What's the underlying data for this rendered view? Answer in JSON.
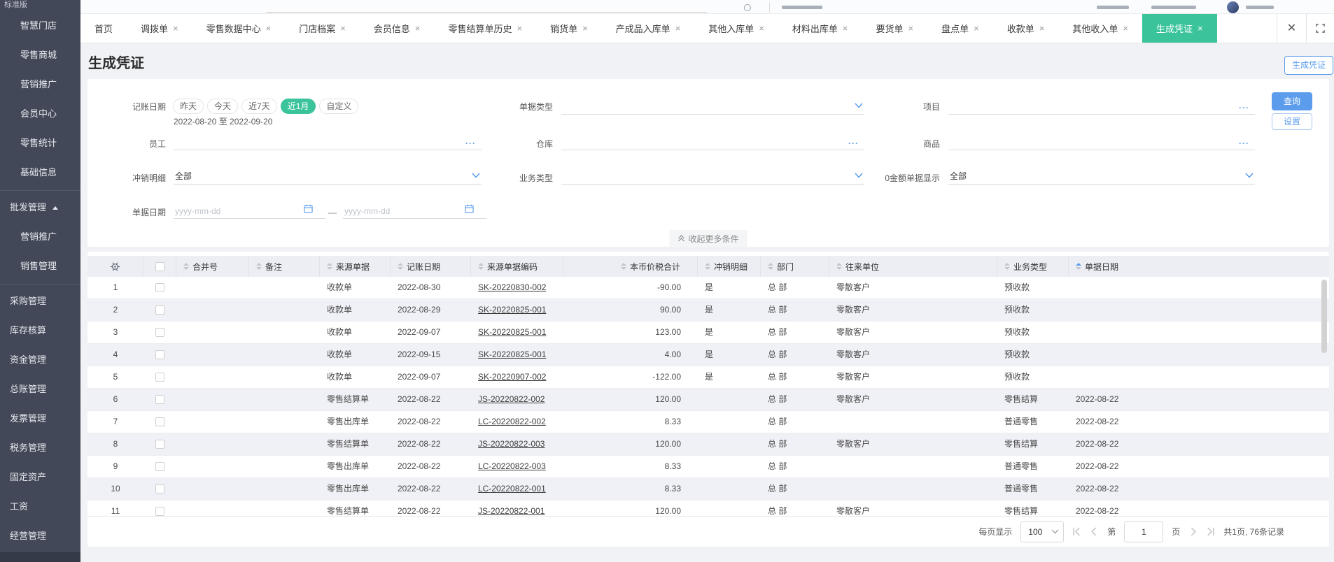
{
  "app": {
    "edition": "标准版"
  },
  "sidebar": {
    "items": [
      {
        "label": "智慧门店",
        "kind": "sub"
      },
      {
        "label": "零售商城",
        "kind": "sub"
      },
      {
        "label": "营销推广",
        "kind": "sub"
      },
      {
        "label": "会员中心",
        "kind": "sub"
      },
      {
        "label": "零售统计",
        "kind": "sub"
      },
      {
        "label": "基础信息",
        "kind": "sub"
      },
      {
        "kind": "sep"
      },
      {
        "label": "批发管理",
        "kind": "group",
        "expanded": true
      },
      {
        "label": "营销推广",
        "kind": "sub"
      },
      {
        "label": "销售管理",
        "kind": "sub"
      },
      {
        "kind": "sep"
      },
      {
        "label": "采购管理",
        "kind": "item"
      },
      {
        "label": "库存核算",
        "kind": "item"
      },
      {
        "label": "资金管理",
        "kind": "item"
      },
      {
        "label": "总账管理",
        "kind": "item"
      },
      {
        "label": "发票管理",
        "kind": "item"
      },
      {
        "label": "税务管理",
        "kind": "item"
      },
      {
        "label": "固定资产",
        "kind": "item"
      },
      {
        "label": "工资",
        "kind": "item"
      },
      {
        "label": "经营管理",
        "kind": "item"
      }
    ]
  },
  "tabs": {
    "items": [
      {
        "label": "首页",
        "closable": false,
        "active": false
      },
      {
        "label": "调拨单",
        "closable": true,
        "active": false
      },
      {
        "label": "零售数据中心",
        "closable": true,
        "active": false
      },
      {
        "label": "门店档案",
        "closable": true,
        "active": false
      },
      {
        "label": "会员信息",
        "closable": true,
        "active": false
      },
      {
        "label": "零售结算单历史",
        "closable": true,
        "active": false
      },
      {
        "label": "销货单",
        "closable": true,
        "active": false
      },
      {
        "label": "产成品入库单",
        "closable": true,
        "active": false
      },
      {
        "label": "其他入库单",
        "closable": true,
        "active": false
      },
      {
        "label": "材料出库单",
        "closable": true,
        "active": false
      },
      {
        "label": "要货单",
        "closable": true,
        "active": false
      },
      {
        "label": "盘点单",
        "closable": true,
        "active": false
      },
      {
        "label": "收款单",
        "closable": true,
        "active": false
      },
      {
        "label": "其他收入单",
        "closable": true,
        "active": false
      },
      {
        "label": "生成凭证",
        "closable": true,
        "active": true
      }
    ]
  },
  "page": {
    "title": "生成凭证",
    "generate_button": "生成凭证"
  },
  "filters": {
    "accounting_date_label": "记账日期",
    "quick_ranges": [
      {
        "label": "昨天",
        "active": false
      },
      {
        "label": "今天",
        "active": false
      },
      {
        "label": "近7天",
        "active": false
      },
      {
        "label": "近1月",
        "active": true
      },
      {
        "label": "自定义",
        "active": false
      }
    ],
    "date_range_text": "2022-08-20 至 2022-09-20",
    "doc_type_label": "单据类型",
    "project_label": "项目",
    "employee_label": "员工",
    "warehouse_label": "仓库",
    "goods_label": "商品",
    "writeoff_label": "冲销明细",
    "writeoff_value": "全部",
    "biz_type_label": "业务类型",
    "zero_amount_label": "0金额单据显示",
    "zero_amount_value": "全部",
    "doc_date_label": "单据日期",
    "date_placeholder": "yyyy-mm-dd",
    "dash": "—",
    "query_button": "查询",
    "settings_button": "设置",
    "collapse_label": "收起更多条件"
  },
  "table": {
    "columns": [
      {
        "label": "合并号"
      },
      {
        "label": "备注"
      },
      {
        "label": "来源单据"
      },
      {
        "label": "记账日期"
      },
      {
        "label": "来源单据编码"
      },
      {
        "label": "本币价税合计",
        "align": "right"
      },
      {
        "label": "冲销明细"
      },
      {
        "label": "部门"
      },
      {
        "label": "往来单位"
      },
      {
        "label": "业务类型"
      },
      {
        "label": "单据日期",
        "sorted": "asc"
      }
    ],
    "rows": [
      {
        "num": "1",
        "merge": "",
        "remark": "",
        "source": "收款单",
        "pdate": "2022-08-30",
        "code": "SK-20220830-002",
        "amount": "-90.00",
        "writeoff": "是",
        "dept": "总 部",
        "unit": "零散客户",
        "biz": "预收款",
        "ddate": ""
      },
      {
        "num": "2",
        "merge": "",
        "remark": "",
        "source": "收款单",
        "pdate": "2022-08-29",
        "code": "SK-20220825-001",
        "amount": "90.00",
        "writeoff": "是",
        "dept": "总 部",
        "unit": "零散客户",
        "biz": "预收款",
        "ddate": ""
      },
      {
        "num": "3",
        "merge": "",
        "remark": "",
        "source": "收款单",
        "pdate": "2022-09-07",
        "code": "SK-20220825-001",
        "amount": "123.00",
        "writeoff": "是",
        "dept": "总 部",
        "unit": "零散客户",
        "biz": "预收款",
        "ddate": ""
      },
      {
        "num": "4",
        "merge": "",
        "remark": "",
        "source": "收款单",
        "pdate": "2022-09-15",
        "code": "SK-20220825-001",
        "amount": "4.00",
        "writeoff": "是",
        "dept": "总 部",
        "unit": "零散客户",
        "biz": "预收款",
        "ddate": ""
      },
      {
        "num": "5",
        "merge": "",
        "remark": "",
        "source": "收款单",
        "pdate": "2022-09-07",
        "code": "SK-20220907-002",
        "amount": "-122.00",
        "writeoff": "是",
        "dept": "总 部",
        "unit": "零散客户",
        "biz": "预收款",
        "ddate": ""
      },
      {
        "num": "6",
        "merge": "",
        "remark": "",
        "source": "零售结算单",
        "pdate": "2022-08-22",
        "code": "JS-20220822-002",
        "amount": "120.00",
        "writeoff": "",
        "dept": "总 部",
        "unit": "零散客户",
        "biz": "零售结算",
        "ddate": "2022-08-22"
      },
      {
        "num": "7",
        "merge": "",
        "remark": "",
        "source": "零售出库单",
        "pdate": "2022-08-22",
        "code": "LC-20220822-002",
        "amount": "8.33",
        "writeoff": "",
        "dept": "总 部",
        "unit": "",
        "biz": "普通零售",
        "ddate": "2022-08-22"
      },
      {
        "num": "8",
        "merge": "",
        "remark": "",
        "source": "零售结算单",
        "pdate": "2022-08-22",
        "code": "JS-20220822-003",
        "amount": "120.00",
        "writeoff": "",
        "dept": "总 部",
        "unit": "零散客户",
        "biz": "零售结算",
        "ddate": "2022-08-22"
      },
      {
        "num": "9",
        "merge": "",
        "remark": "",
        "source": "零售出库单",
        "pdate": "2022-08-22",
        "code": "LC-20220822-003",
        "amount": "8.33",
        "writeoff": "",
        "dept": "总 部",
        "unit": "",
        "biz": "普通零售",
        "ddate": "2022-08-22"
      },
      {
        "num": "10",
        "merge": "",
        "remark": "",
        "source": "零售出库单",
        "pdate": "2022-08-22",
        "code": "LC-20220822-001",
        "amount": "8.33",
        "writeoff": "",
        "dept": "总 部",
        "unit": "",
        "biz": "普通零售",
        "ddate": "2022-08-22"
      },
      {
        "num": "11",
        "merge": "",
        "remark": "",
        "source": "零售结算单",
        "pdate": "2022-08-22",
        "code": "JS-20220822-001",
        "amount": "120.00",
        "writeoff": "",
        "dept": "总 部",
        "unit": "零散客户",
        "biz": "零售结算",
        "ddate": "2022-08-22"
      }
    ]
  },
  "pagination": {
    "per_page_label": "每页显示",
    "per_page_value": "100",
    "page_prefix": "第",
    "page_value": "1",
    "page_suffix": "页",
    "total_text": "共1页, 76条记录"
  },
  "colors": {
    "accent_green": "#3bc49b",
    "accent_blue": "#5b9cec"
  }
}
